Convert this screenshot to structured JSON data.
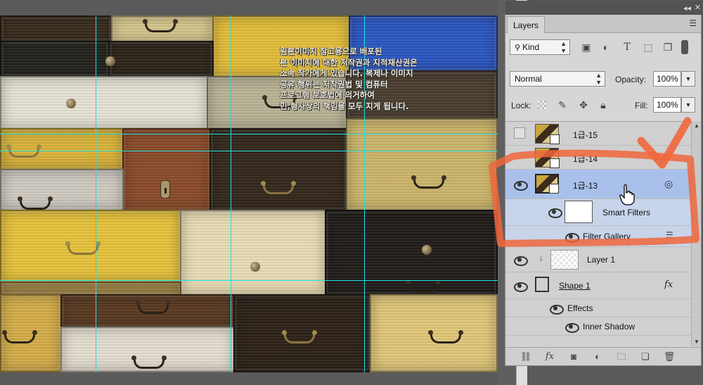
{
  "canvas": {
    "watermark_lines": [
      "원본이미지 참고용으로 배포된",
      "본 이미지에 대한 저작권과 지적재산권은",
      "소속 작가에게 있습니다. 복제나 이미지",
      "공유 행위는 저작권법 및 컴퓨터",
      "프로그램 보호법에 의거하여",
      "민,형사상의 책임을 모두 지게 됩니다."
    ]
  },
  "panel": {
    "tab_label": "Layers",
    "filter_kind": "Kind",
    "blend_mode": "Normal",
    "opacity_label": "Opacity:",
    "opacity_value": "100%",
    "lock_label": "Lock:",
    "fill_label": "Fill:",
    "fill_value": "100%",
    "layers": [
      {
        "name": "1급-15",
        "visible": false
      },
      {
        "name": "1급-14",
        "visible": false
      },
      {
        "name": "1급-13",
        "visible": true,
        "selected": true
      },
      {
        "name": "Smart Filters"
      },
      {
        "name": "Filter Gallery"
      },
      {
        "name": "Layer 1",
        "visible": true
      },
      {
        "name": "Shape 1",
        "visible": true
      },
      {
        "name": "Effects"
      },
      {
        "name": "Inner Shadow"
      }
    ],
    "fx_label": "fx"
  },
  "colors": {
    "guide": "#19e0e0",
    "selection": "#a9c0ea",
    "annotation": "#f0663c"
  }
}
